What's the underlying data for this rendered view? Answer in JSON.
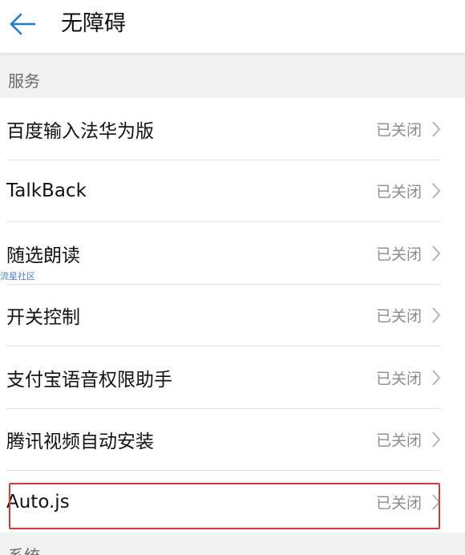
{
  "header": {
    "title": "无障碍",
    "back_icon": "arrow-left-icon",
    "accent_color": "#1a7fd4"
  },
  "services_section": {
    "label": "服务",
    "items": [
      {
        "label": "百度输入法华为版",
        "status": "已关闭"
      },
      {
        "label": "TalkBack",
        "status": "已关闭"
      },
      {
        "label": "随选朗读",
        "status": "已关闭"
      },
      {
        "label": "开关控制",
        "status": "已关闭"
      },
      {
        "label": "支付宝语音权限助手",
        "status": "已关闭"
      },
      {
        "label": "腾讯视频自动安装",
        "status": "已关闭"
      },
      {
        "label": "Auto.js",
        "status": "已关闭"
      }
    ]
  },
  "watermark": "流星社区",
  "system_section": {
    "label": "系统"
  },
  "highlight_color": "#d63a36"
}
